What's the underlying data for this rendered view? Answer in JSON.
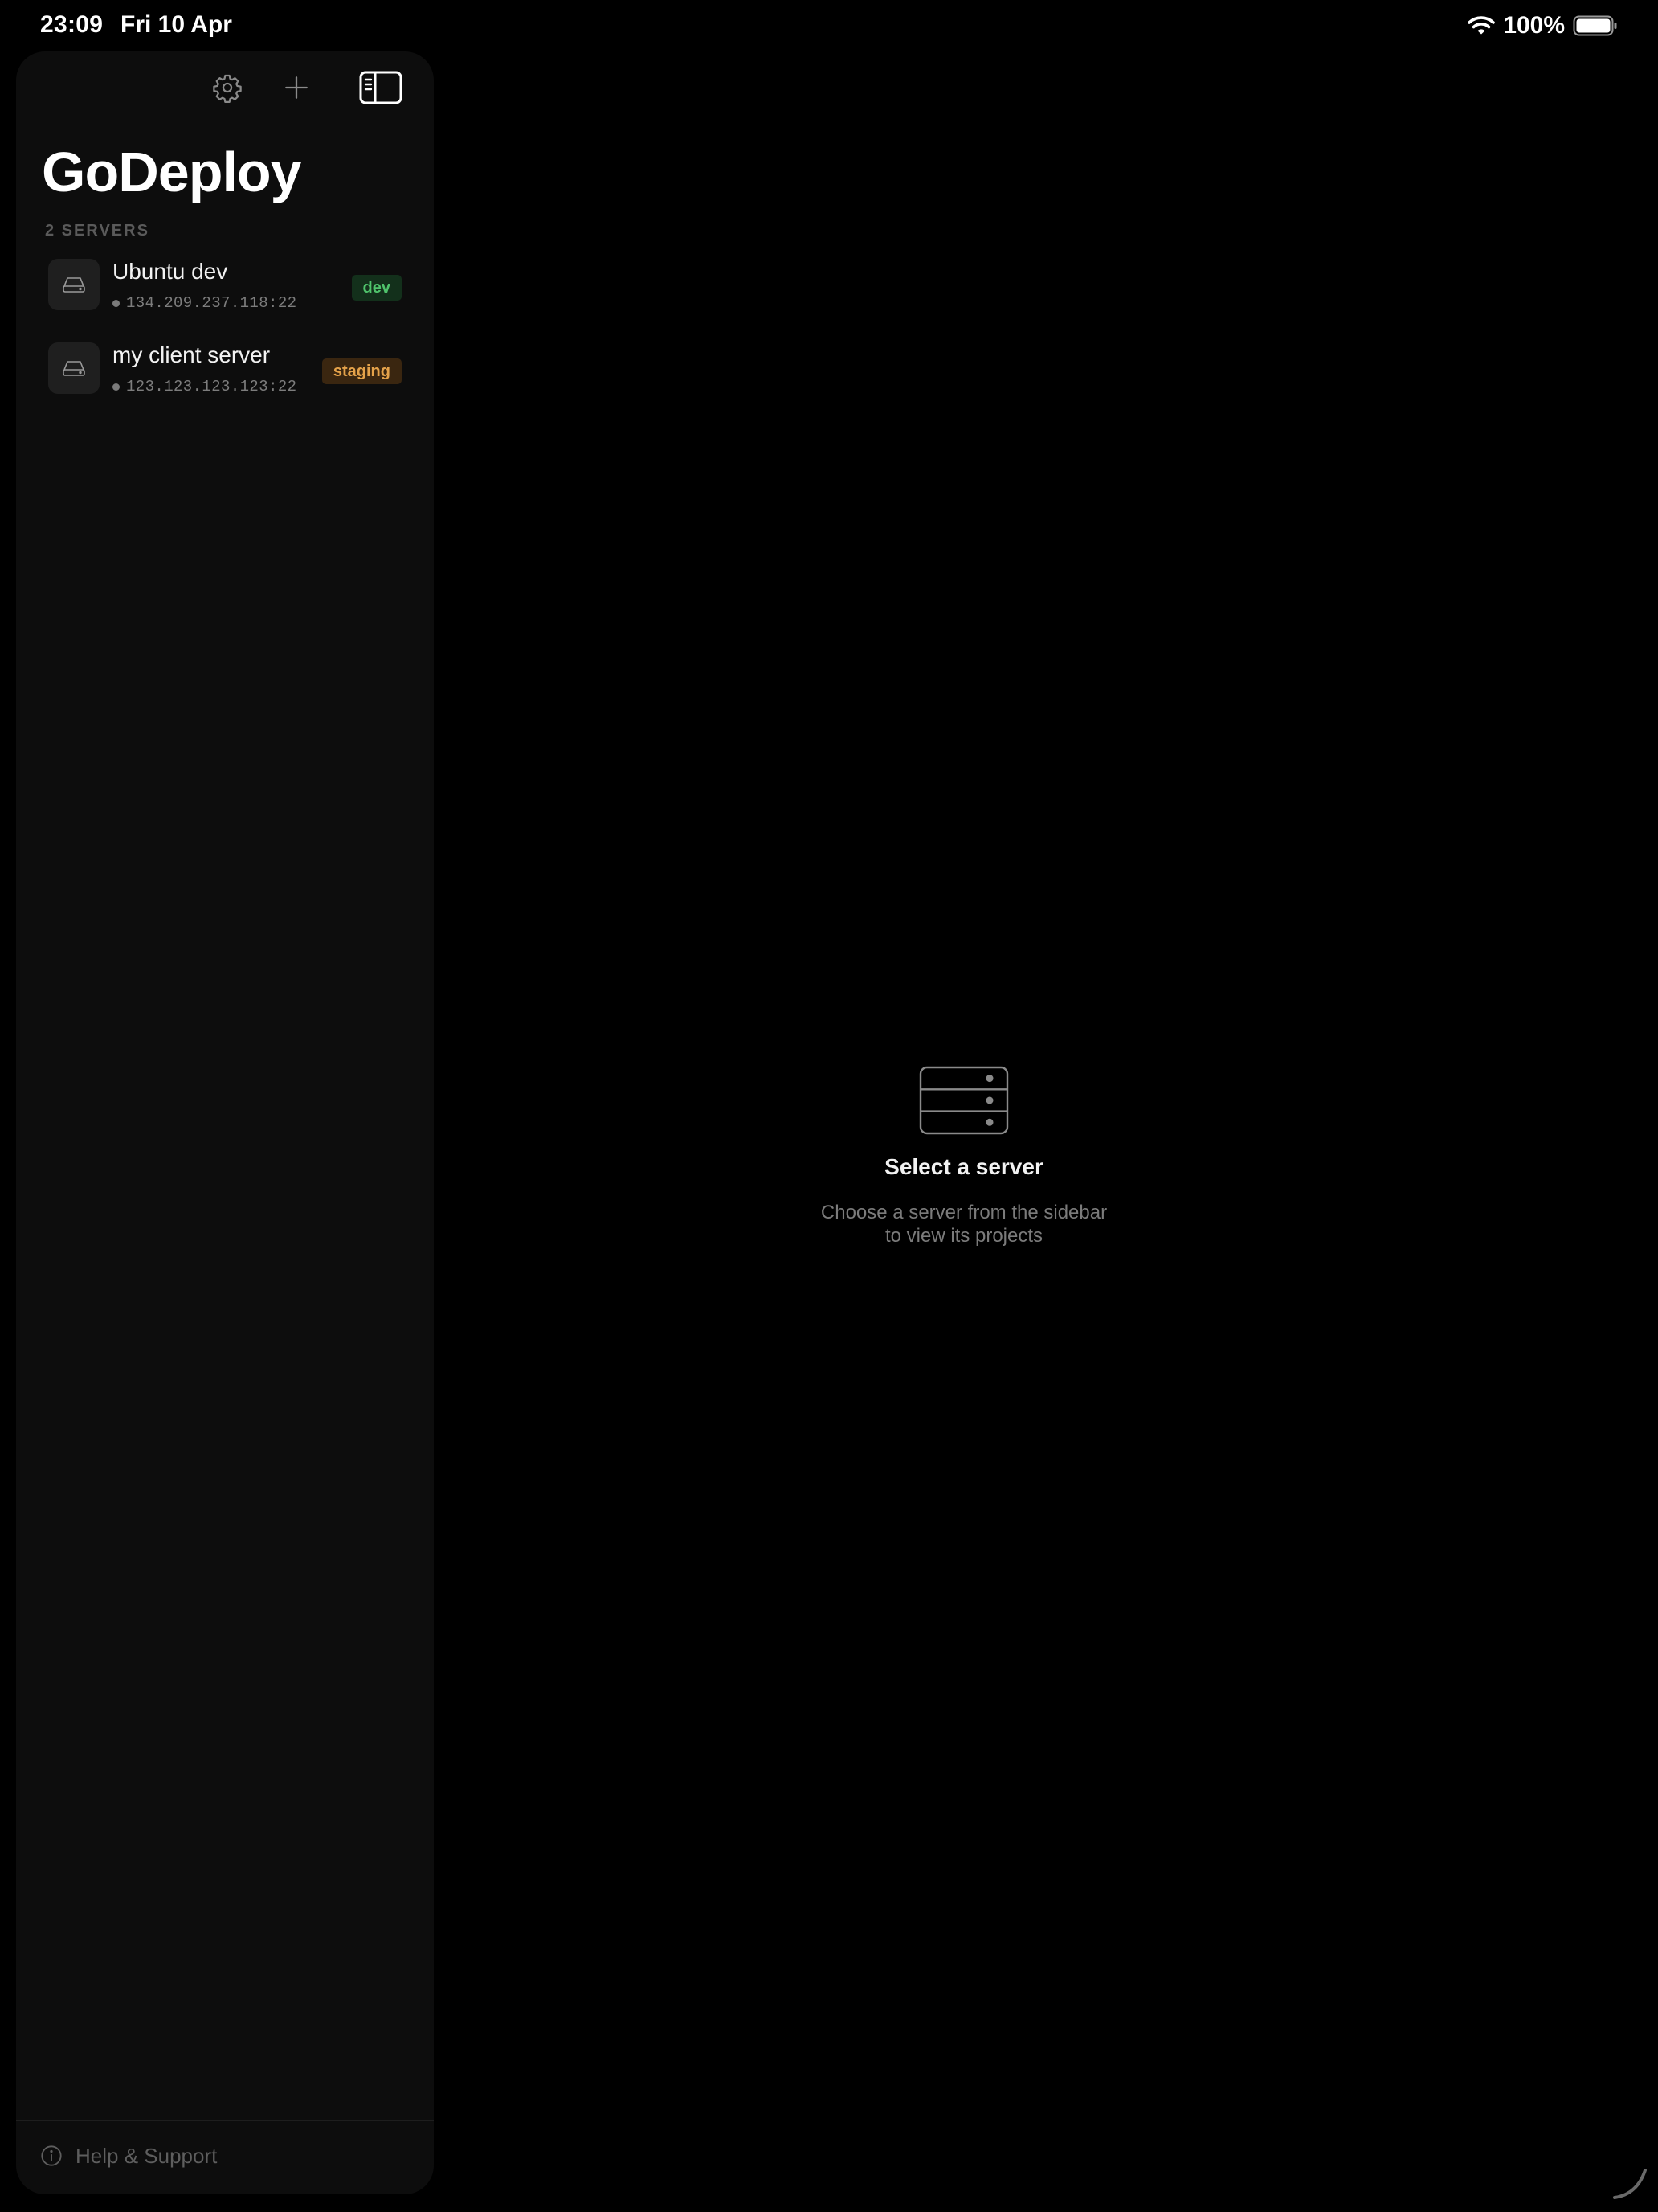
{
  "status_bar": {
    "time": "23:09",
    "date": "Fri 10 Apr",
    "battery": "100%",
    "wifi_icon": "wifi-icon",
    "battery_icon": "battery-icon"
  },
  "sidebar": {
    "toolbar": {
      "settings_icon": "gear-icon",
      "add_icon": "plus-icon",
      "toggle_icon": "sidebar-toggle-icon"
    },
    "title": "GoDeploy",
    "section_label": "2 SERVERS",
    "servers": [
      {
        "name": "Ubuntu dev",
        "address": "134.209.237.118:22",
        "tag": "dev"
      },
      {
        "name": "my client server",
        "address": "123.123.123.123:22",
        "tag": "staging"
      }
    ],
    "help_label": "Help & Support"
  },
  "main": {
    "empty_icon": "server-rack-icon",
    "title": "Select a server",
    "subtitle_line1": "Choose a server from the sidebar",
    "subtitle_line2": "to view its projects"
  },
  "colors": {
    "background": "#000000",
    "sidebar": "#0d0d0d",
    "tag_dev_bg": "#13301b",
    "tag_dev_text": "#4fc26b",
    "tag_staging_bg": "#3a2610",
    "tag_staging_text": "#e4a24a"
  }
}
